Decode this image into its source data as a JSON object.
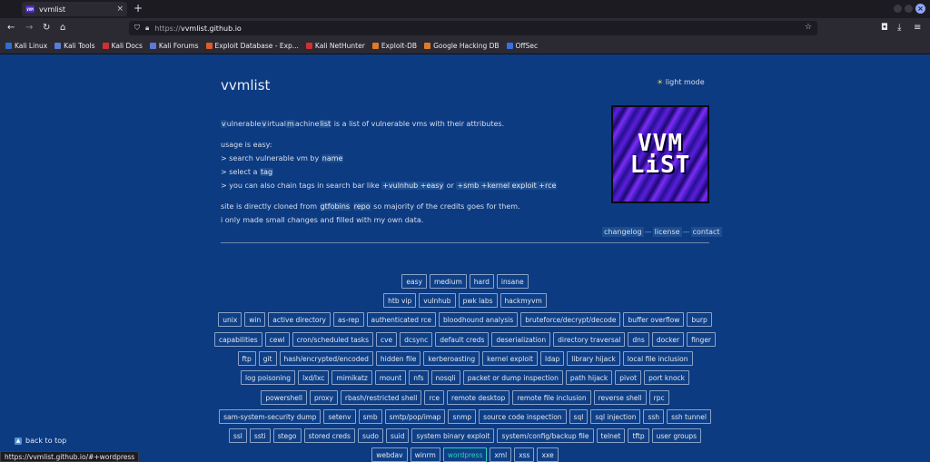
{
  "browser": {
    "tab_title": "vvmlist",
    "favicon_text": "VVM",
    "url_prefix": "https://",
    "url_host": "vvmlist.github.io",
    "bookmarks": [
      {
        "label": "Kali Linux",
        "color": "#2f6fd0"
      },
      {
        "label": "Kali Tools",
        "color": "#5a7bd8"
      },
      {
        "label": "Kali Docs",
        "color": "#d03030"
      },
      {
        "label": "Kali Forums",
        "color": "#5a7bd8"
      },
      {
        "label": "Exploit Database - Exp...",
        "color": "#e05a2a"
      },
      {
        "label": "Kali NetHunter",
        "color": "#d03030"
      },
      {
        "label": "Exploit-DB",
        "color": "#e07a2a"
      },
      {
        "label": "Google Hacking DB",
        "color": "#e07a2a"
      },
      {
        "label": "OffSec",
        "color": "#3a6fe0"
      }
    ],
    "status_url": "https://vvmlist.github.io/#+wordpress"
  },
  "site": {
    "title": "vvmlist",
    "light_mode": "light mode",
    "intro": {
      "w1_first": "v",
      "w1_rest": "ulnerable",
      "w2_first": "v",
      "w2_rest": "irtual",
      "w3_first": "m",
      "w3_rest": "achine",
      "w4": "list",
      "tail": " is a list of vulnerable vms with their attributes."
    },
    "usage": {
      "line1": "usage is easy:",
      "line2_pre": "> search vulnerable vm by ",
      "line2_chip": "name",
      "line3_pre": "> select a ",
      "line3_chip": "tag",
      "line4_pre": "> you can also chain tags in search bar like ",
      "line4_chip1": "+vulnhub +easy",
      "line4_mid": " or ",
      "line4_chip2": "+smb +kernel exploit +rce"
    },
    "credits": {
      "line1_pre": "site is directly cloned from ",
      "line1_chip1": "gtfobins",
      "line1_chip2": "repo",
      "line1_post": " so majority of the credits goes for them.",
      "line2": "i only made small changes and filled with my own data."
    },
    "logo_lines": [
      "VVM",
      "LiST"
    ],
    "links": [
      "changelog",
      "license",
      "contact"
    ],
    "tag_rows": [
      [
        "easy",
        "medium",
        "hard",
        "insane"
      ],
      [
        "htb vip",
        "vulnhub",
        "pwk labs",
        "hackmyvm"
      ],
      [
        "unix",
        "win",
        "active directory",
        "as-rep",
        "authenticated rce",
        "bloodhound analysis",
        "bruteforce/decrypt/decode",
        "buffer overflow",
        "burp"
      ],
      [
        "capabilities",
        "cewl",
        "cron/scheduled tasks",
        "cve",
        "dcsync",
        "default creds",
        "deserialization",
        "directory traversal",
        "dns",
        "docker",
        "finger"
      ],
      [
        "ftp",
        "git",
        "hash/encrypted/encoded",
        "hidden file",
        "kerberoasting",
        "kernel exploit",
        "ldap",
        "library hijack",
        "local file inclusion"
      ],
      [
        "log poisoning",
        "lxd/lxc",
        "mimikatz",
        "mount",
        "nfs",
        "nosqli",
        "packet or dump inspection",
        "path hijack",
        "pivot",
        "port knock"
      ],
      [
        "powershell",
        "proxy",
        "rbash/restricted shell",
        "rce",
        "remote desktop",
        "remote file inclusion",
        "reverse shell",
        "rpc"
      ],
      [
        "sam-system-security dump",
        "setenv",
        "smb",
        "smtp/pop/imap",
        "snmp",
        "source code inspection",
        "sql",
        "sql injection",
        "ssh",
        "ssh tunnel"
      ],
      [
        "ssl",
        "ssti",
        "stego",
        "stored creds",
        "sudo",
        "suid",
        "system binary exploit",
        "system/config/backup file",
        "telnet",
        "tftp",
        "user groups"
      ],
      [
        "webdav",
        "winrm",
        "wordpress",
        "xml",
        "xss",
        "xxe"
      ]
    ],
    "active_tag": "wordpress",
    "back_to_top": "back to top"
  }
}
